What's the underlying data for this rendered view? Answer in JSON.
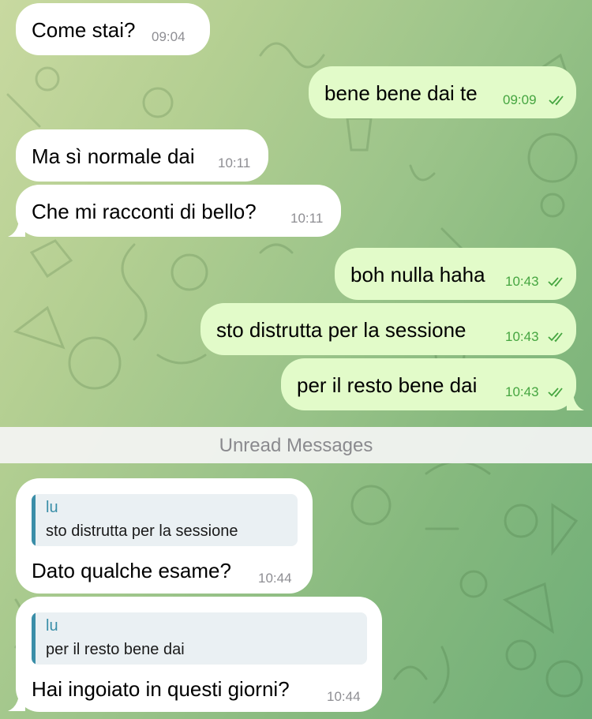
{
  "colors": {
    "incoming_bubble": "#ffffff",
    "outgoing_bubble": "#e2fbc9",
    "outgoing_time": "#45a540",
    "incoming_time": "#8e8e93",
    "reply_accent": "#3a8ea8"
  },
  "messages_before": [
    {
      "text": "Come stai?",
      "time": "09:04",
      "direction": "incoming"
    },
    {
      "text": "bene bene dai te",
      "time": "09:09",
      "direction": "outgoing",
      "status": "read-double-check"
    },
    {
      "text": "Ma sì normale dai",
      "time": "10:11",
      "direction": "incoming"
    },
    {
      "text": "Che mi racconti di bello?",
      "time": "10:11",
      "direction": "incoming"
    },
    {
      "text": "boh nulla haha",
      "time": "10:43",
      "direction": "outgoing",
      "status": "read-double-check"
    },
    {
      "text": "sto distrutta per la sessione",
      "time": "10:43",
      "direction": "outgoing",
      "status": "read-double-check"
    },
    {
      "text": "per il resto bene dai",
      "time": "10:43",
      "direction": "outgoing",
      "status": "read-double-check"
    }
  ],
  "unread_divider": "Unread Messages",
  "messages_after": [
    {
      "reply_to": {
        "name": "lu",
        "text": "sto distrutta per la sessione"
      },
      "text": "Dato qualche esame?",
      "time": "10:44",
      "direction": "incoming"
    },
    {
      "reply_to": {
        "name": "lu",
        "text": "per il resto bene dai"
      },
      "text": "Hai ingoiato in questi giorni?",
      "time": "10:44",
      "direction": "incoming"
    }
  ]
}
